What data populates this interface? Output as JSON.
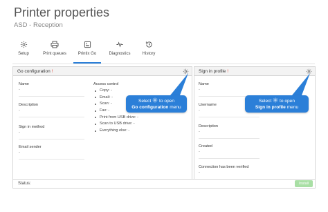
{
  "page": {
    "title": "Printer properties",
    "subtitle": "ASD - Reception"
  },
  "tabs": [
    {
      "label": "Setup",
      "icon": "gear-icon",
      "active": false
    },
    {
      "label": "Print queues",
      "icon": "printer-icon",
      "active": false
    },
    {
      "label": "Printix Go",
      "icon": "image-icon",
      "active": true
    },
    {
      "label": "Diagnostics",
      "icon": "pulse-icon",
      "active": false
    },
    {
      "label": "History",
      "icon": "history-icon",
      "active": false
    }
  ],
  "go_configuration": {
    "title": "Go configuration",
    "required_mark": "!",
    "fields": [
      {
        "label": "Name",
        "value": "-"
      },
      {
        "label": "Description",
        "value": "-"
      },
      {
        "label": "Sign in method",
        "value": "-"
      },
      {
        "label": "Email sender",
        "value": "-"
      }
    ],
    "access_control": {
      "title": "Access control",
      "items": [
        "Copy: -",
        "Email: -",
        "Scan: -",
        "Fax: -",
        "Print from USB drive: -",
        "Scan to USB drive: -",
        "Everything else: -"
      ]
    }
  },
  "sign_in_profile": {
    "title": "Sign in profile",
    "required_mark": "!",
    "fields": [
      {
        "label": "Name",
        "value": "-"
      },
      {
        "label": "Username",
        "value": "-"
      },
      {
        "label": "Description",
        "value": "-"
      },
      {
        "label": "Created",
        "value": "-"
      },
      {
        "label": "Connection has been verified",
        "value": "-"
      }
    ]
  },
  "callouts": {
    "left": {
      "prefix": "Select",
      "suffix": "to open",
      "bold": "Go configuration",
      "tail": "menu"
    },
    "right": {
      "prefix": "Select",
      "suffix": "to open",
      "bold": "Sign in profile",
      "tail": "menu"
    }
  },
  "status_bar": {
    "label": "Status:",
    "install_label": "Install"
  },
  "colors": {
    "accent": "#2b7fd8",
    "required": "#e24a3b",
    "install_disabled": "#a9dfa5"
  }
}
